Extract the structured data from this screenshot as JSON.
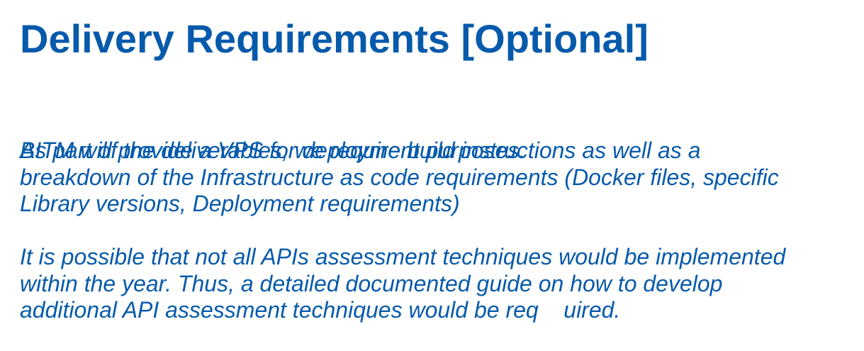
{
  "title": "Delivery Requirements [Optional]",
  "paragraphs": [
    {
      "lines": [
        "BITM will provide a VPS for deployment purposes."
      ]
    },
    {
      "lines": [
        "As part of the deliverables, we require build instructions as well as a",
        "breakdown of the Infrastructure as code requirements (Docker files, specific",
        "Library versions, Deployment requirements)"
      ]
    },
    {
      "lines": [
        "It is possible that not all APIs assessment techniques would be implemented",
        "within the year. Thus, a detailed documented guide on how to develop",
        "additional API assessment techniques would be req    uired."
      ]
    }
  ],
  "colors": {
    "text": "#065aab",
    "background": "#ffffff"
  }
}
